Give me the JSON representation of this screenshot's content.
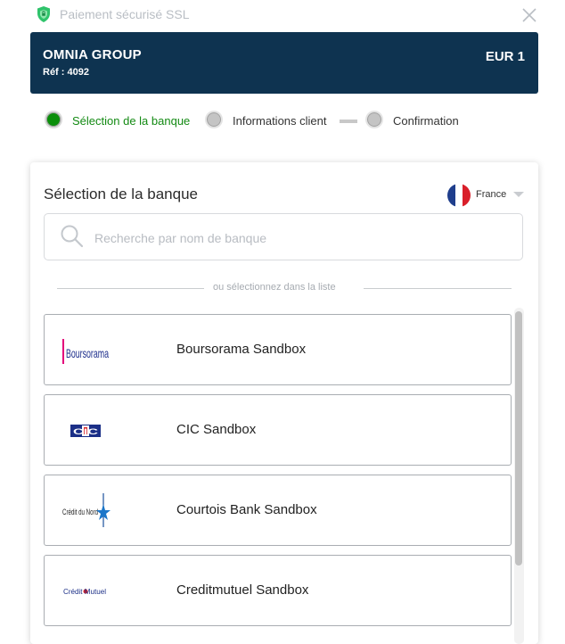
{
  "header": {
    "ssl_text": "Paiement sécurisé SSL",
    "icons": {
      "shield": "shield-icon",
      "close": "close-icon"
    },
    "shield_color": "#2fc36b"
  },
  "merchant": {
    "name": "OMNIA GROUP",
    "ref": "Réf : 4092",
    "amount": "EUR 1",
    "bg_color": "#0e3350"
  },
  "steps": [
    {
      "label": "Sélection de la banque",
      "state": "active"
    },
    {
      "label": "Informations client",
      "state": "inactive"
    },
    {
      "label": "Confirmation",
      "state": "inactive"
    }
  ],
  "bank_selection": {
    "title": "Sélection de la banque",
    "country": "France",
    "search": {
      "placeholder": "Recherche par nom de banque",
      "value": ""
    },
    "divider_text": "ou sélectionnez dans la liste",
    "banks": [
      {
        "name": "Boursorama Sandbox",
        "logo": "boursorama-logo",
        "logo_text": "Boursorama"
      },
      {
        "name": "CIC Sandbox",
        "logo": "cic-logo",
        "logo_text": "CIC"
      },
      {
        "name": "Courtois Bank Sandbox",
        "logo": "credit-du-nord-logo",
        "logo_text": "Crédit du Nord"
      },
      {
        "name": "Creditmutuel Sandbox",
        "logo": "credit-mutuel-logo",
        "logo_text": "Crédit Mutuel"
      }
    ]
  },
  "colors": {
    "active_step": "#0a8f0a",
    "inactive_step": "#c4c4c4",
    "accent_text": "#138a13"
  }
}
